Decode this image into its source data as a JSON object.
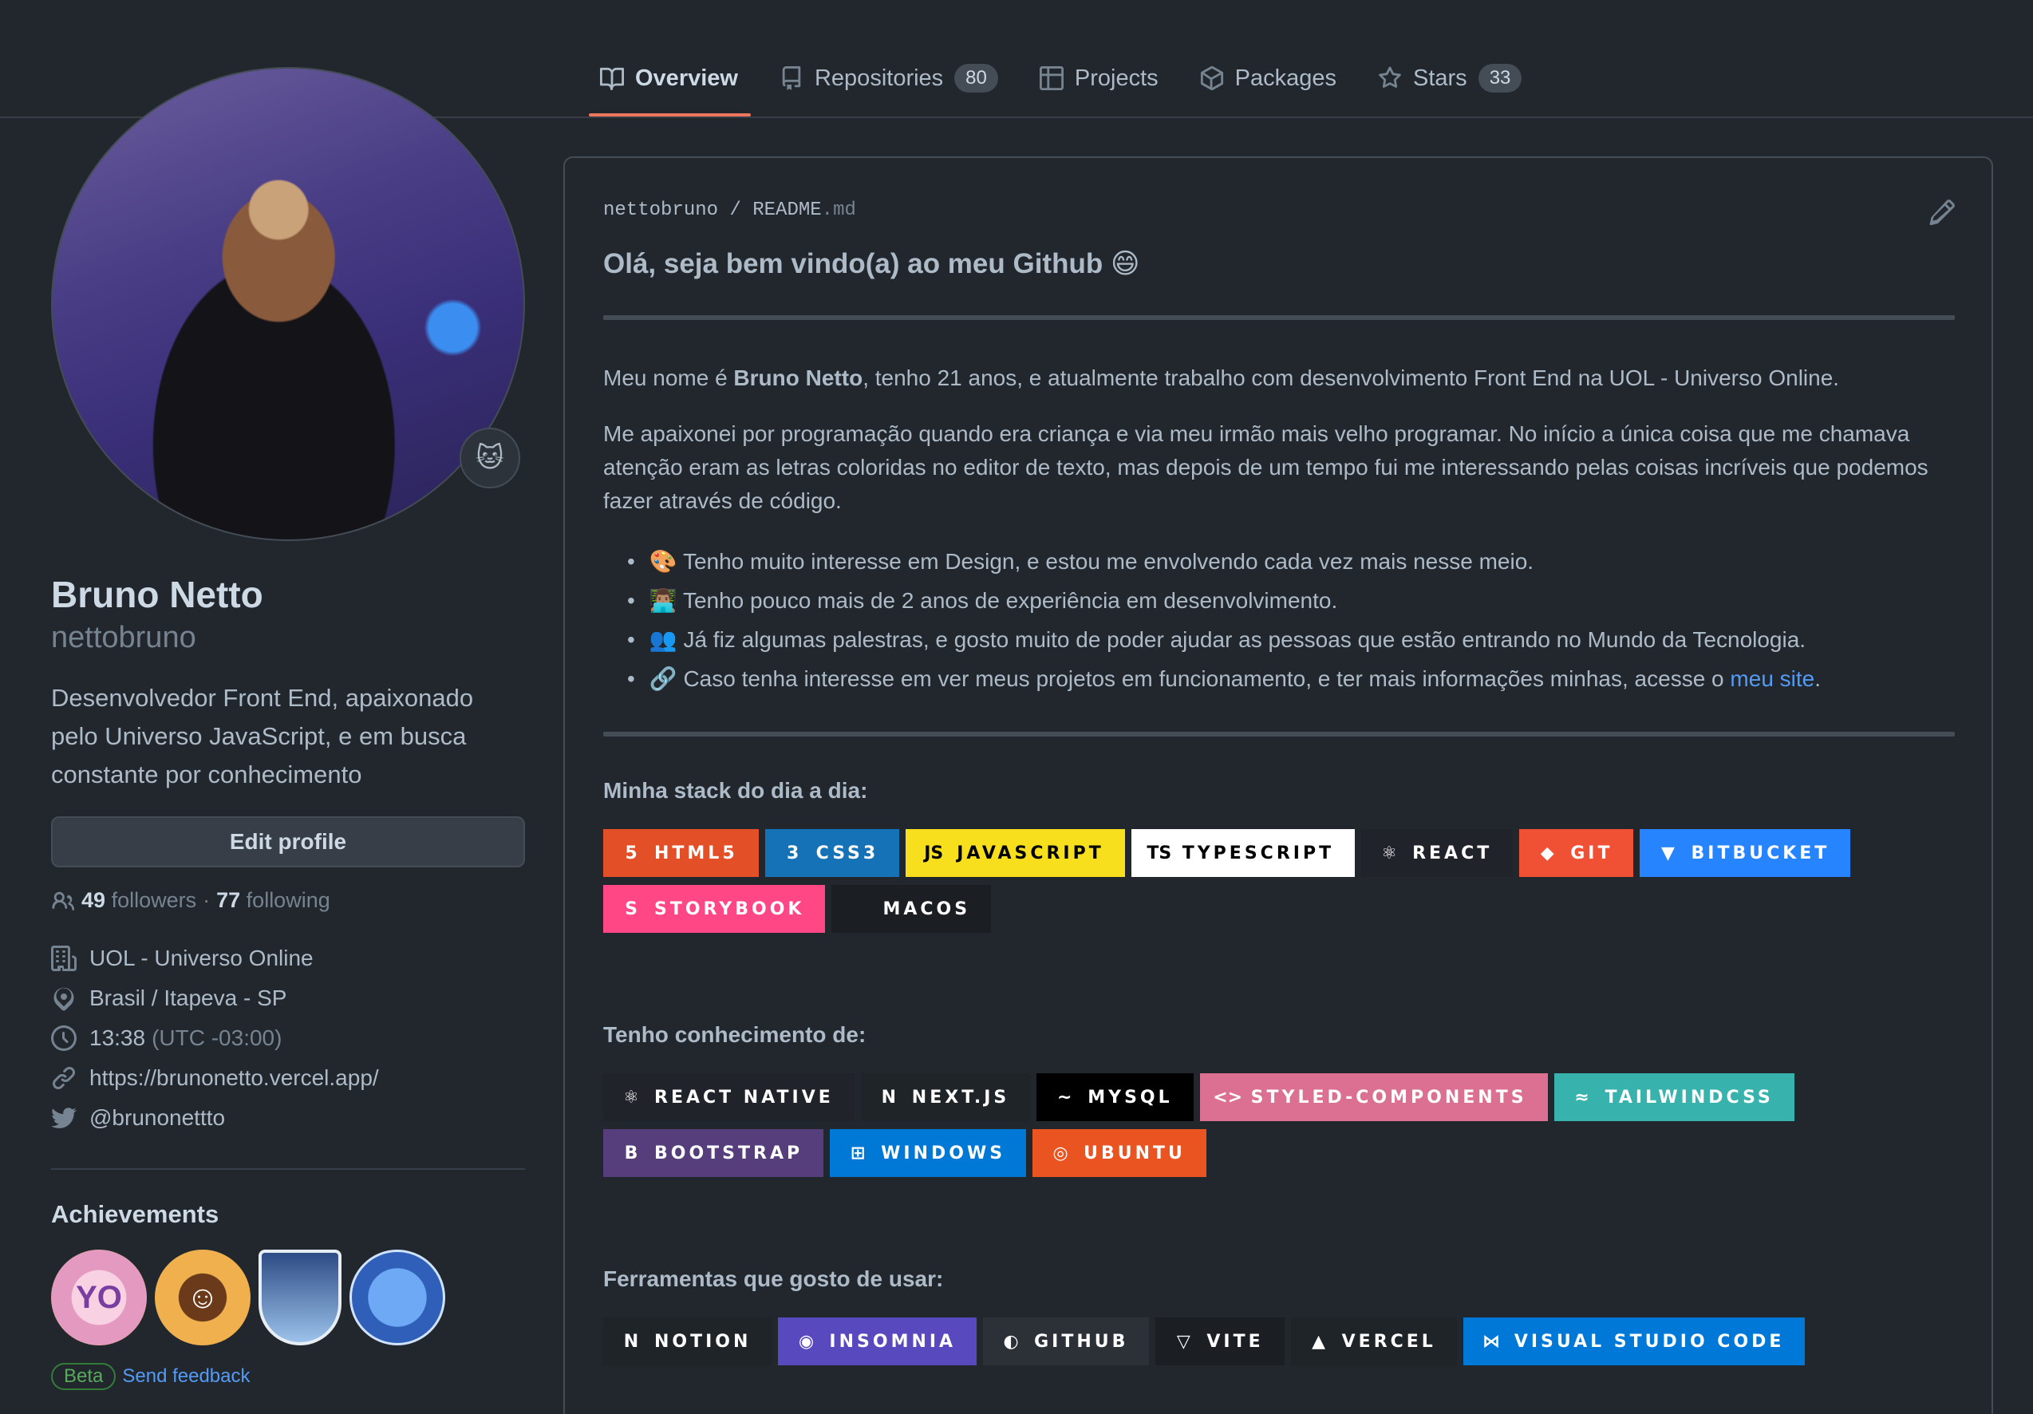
{
  "tabs": [
    {
      "label": "Overview",
      "icon": "book-icon"
    },
    {
      "label": "Repositories",
      "count": "80",
      "icon": "repo-icon"
    },
    {
      "label": "Projects",
      "icon": "table-icon"
    },
    {
      "label": "Packages",
      "icon": "package-icon"
    },
    {
      "label": "Stars",
      "count": "33",
      "icon": "star-icon"
    }
  ],
  "profile": {
    "fullname": "Bruno Netto",
    "username": "nettobruno",
    "bio": "Desenvolvedor Front End, apaixonado pelo Universo JavaScript, e em busca constante por conhecimento",
    "edit_label": "Edit profile",
    "followers_count": "49",
    "followers_label": "followers",
    "dot": "·",
    "following_count": "77",
    "following_label": "following",
    "company": "UOL - Universo Online",
    "location": "Brasil / Itapeva - SP",
    "time": "13:38",
    "timezone": "(UTC -03:00)",
    "website": "https://brunonetto.vercel.app/",
    "twitter": "@brunonettto",
    "achievements_title": "Achievements",
    "beta_label": "Beta",
    "feedback_label": "Send feedback"
  },
  "readme": {
    "path_user": "nettobruno",
    "path_sep": "/",
    "path_file": "README",
    "path_ext": ".md",
    "heading": "Olá, seja bem vindo(a) ao meu Github 😄",
    "p1_pre": "Meu nome é ",
    "p1_bold": "Bruno Netto",
    "p1_post": ", tenho 21 anos, e atualmente trabalho com desenvolvimento Front End na UOL - Universo Online.",
    "p2": "Me apaixonei por programação quando era criança e via meu irmão mais velho programar. No início a única coisa que me chamava atenção eram as letras coloridas no editor de texto, mas depois de um tempo fui me interessando pelas coisas incríveis que podemos fazer através de código.",
    "bullets": [
      "🎨 Tenho muito interesse em Design, e estou me envolvendo cada vez mais nesse meio.",
      "👨🏽‍💻 Tenho pouco mais de 2 anos de experiência em desenvolvimento.",
      "👥 Já fiz algumas palestras, e gosto muito de poder ajudar as pessoas que estão entrando no Mundo da Tecnologia."
    ],
    "bullet4_pre": "🔗 Caso tenha interesse em ver meus projetos em funcionamento, e ter mais informações minhas, acesse o ",
    "bullet4_link": "meu site",
    "bullet4_post": ".",
    "stack_title": "Minha stack do dia a dia:",
    "known_title": "Tenho conhecimento de:",
    "tools_title": "Ferramentas que gosto de usar:",
    "stack": [
      {
        "label": "HTML5",
        "bg": "#E34F26",
        "fg": "#ffffff",
        "icon": "5"
      },
      {
        "label": "CSS3",
        "bg": "#1572B6",
        "fg": "#ffffff",
        "icon": "3"
      },
      {
        "label": "JAVASCRIPT",
        "bg": "#F7DF1E",
        "fg": "#000000",
        "icon": "JS"
      },
      {
        "label": "TYPESCRIPT",
        "bg": "#ffffff",
        "fg": "#000000",
        "icon": "TS"
      },
      {
        "label": "REACT",
        "bg": "#20232a",
        "fg": "#ffffff",
        "icon": "⚛"
      },
      {
        "label": "GIT",
        "bg": "#F05033",
        "fg": "#ffffff",
        "icon": "◆"
      },
      {
        "label": "BITBUCKET",
        "bg": "#2684FF",
        "fg": "#ffffff",
        "icon": "▼"
      },
      {
        "label": "STORYBOOK",
        "bg": "#FF4785",
        "fg": "#ffffff",
        "icon": "S"
      },
      {
        "label": "MACOS",
        "bg": "#1b1f24",
        "fg": "#ffffff",
        "icon": ""
      }
    ],
    "known": [
      {
        "label": "REACT NATIVE",
        "bg": "#20232a",
        "fg": "#ffffff",
        "icon": "⚛"
      },
      {
        "label": "NEXT.JS",
        "bg": "#1f2428",
        "fg": "#ffffff",
        "icon": "N"
      },
      {
        "label": "MYSQL",
        "bg": "#000000",
        "fg": "#ffffff",
        "icon": "~"
      },
      {
        "label": "STYLED-COMPONENTS",
        "bg": "#DB7093",
        "fg": "#ffffff",
        "icon": "<>"
      },
      {
        "label": "TAILWINDCSS",
        "bg": "#38B2AC",
        "fg": "#ffffff",
        "icon": "≈"
      },
      {
        "label": "BOOTSTRAP",
        "bg": "#563D7C",
        "fg": "#ffffff",
        "icon": "B"
      },
      {
        "label": "WINDOWS",
        "bg": "#0078D6",
        "fg": "#ffffff",
        "icon": "⊞"
      },
      {
        "label": "UBUNTU",
        "bg": "#E95420",
        "fg": "#ffffff",
        "icon": "◎"
      }
    ],
    "tools": [
      {
        "label": "NOTION",
        "bg": "#1f2428",
        "fg": "#ffffff",
        "icon": "N"
      },
      {
        "label": "INSOMNIA",
        "bg": "#5849BE",
        "fg": "#ffffff",
        "icon": "◉"
      },
      {
        "label": "GITHUB",
        "bg": "#2b3137",
        "fg": "#ffffff",
        "icon": "◐"
      },
      {
        "label": "VITE",
        "bg": "#1b1f24",
        "fg": "#ffffff",
        "icon": "▽"
      },
      {
        "label": "VERCEL",
        "bg": "#1f2428",
        "fg": "#ffffff",
        "icon": "▲"
      },
      {
        "label": "VISUAL STUDIO CODE",
        "bg": "#0078d7",
        "fg": "#ffffff",
        "icon": "⋈"
      }
    ]
  },
  "colors": {
    "accent": "#ec775c",
    "link": "#539bf5",
    "bg": "#22272e"
  }
}
